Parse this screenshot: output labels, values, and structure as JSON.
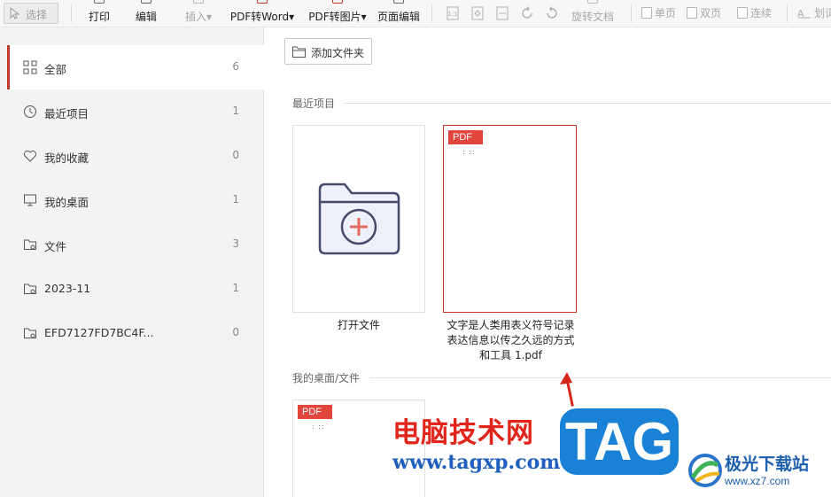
{
  "toolbar": {
    "select_label": "选择",
    "print_label": "打印",
    "edit_label": "编辑",
    "insert_label": "插入▾",
    "pdf_to_word_label": "PDF转Word▾",
    "pdf_to_image_label": "PDF转图片▾",
    "page_edit_label": "页面编辑",
    "rotate_doc_label": "旋转文档",
    "single_page_label": "单页",
    "double_page_label": "双页",
    "continuous_label": "连续",
    "partial_label": "划词"
  },
  "sidebar": {
    "items": [
      {
        "label": "全部",
        "count": "6",
        "icon": "grid-icon"
      },
      {
        "label": "最近项目",
        "count": "1",
        "icon": "clock-icon"
      },
      {
        "label": "我的收藏",
        "count": "0",
        "icon": "heart-icon"
      },
      {
        "label": "我的桌面",
        "count": "1",
        "icon": "monitor-icon"
      },
      {
        "label": "文件",
        "count": "3",
        "icon": "folder-icon"
      },
      {
        "label": "2023-11",
        "count": "1",
        "icon": "folder-icon"
      },
      {
        "label": "EFD7127FD7BC4F...",
        "count": "0",
        "icon": "folder-icon"
      }
    ]
  },
  "main": {
    "add_folder_label": "添加文件夹",
    "recent_section": "最近项目",
    "desktop_section": "我的桌面/文件",
    "open_file_label": "打开文件",
    "recent_file_line1": "文字是人类用表义符号记录",
    "recent_file_line2": "表达信息以传之久远的方式",
    "recent_file_line3": "和工具 1.pdf",
    "pdf_badge": "PDF",
    "dots": ": ::"
  },
  "watermark": {
    "site_name": "电脑技术网",
    "site_url": "www.tagxp.com",
    "tag": "TAG",
    "brand_name": "极光下载站",
    "brand_url": "www.xz7.com"
  },
  "colors": {
    "accent": "#c0392b",
    "pdf_badge": "#e0463b",
    "tag_blue": "#1a82d6"
  }
}
